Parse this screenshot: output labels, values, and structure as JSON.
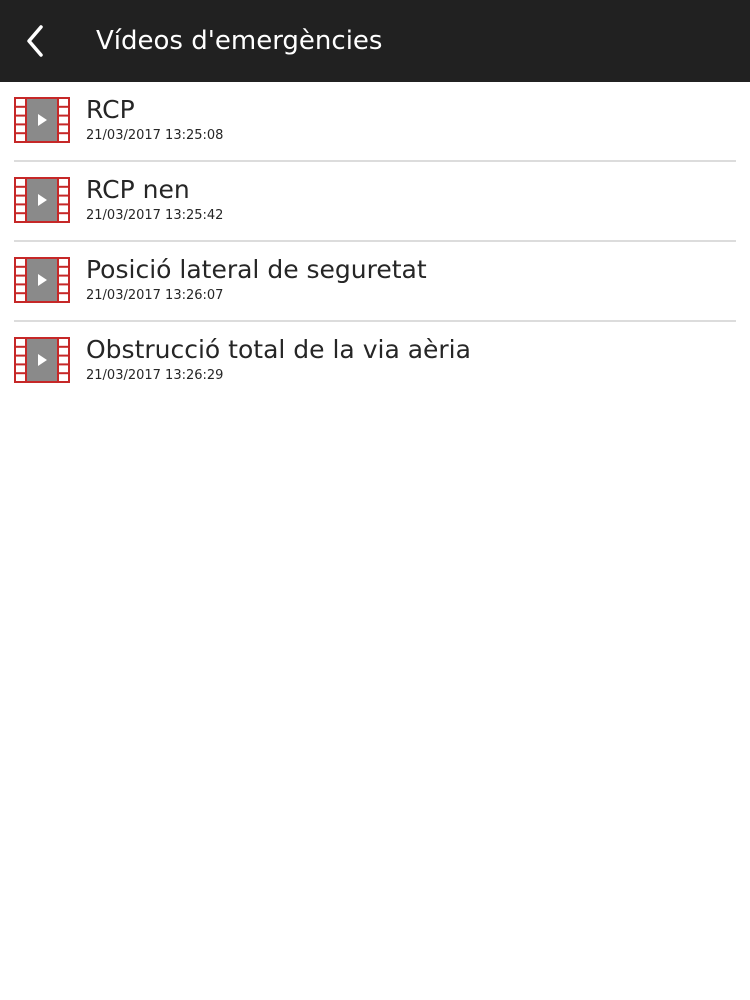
{
  "header": {
    "back_icon": "chevron-left-icon",
    "title": "Vídeos d'emergències",
    "background_color": "#212121"
  },
  "videos": [
    {
      "title": "RCP",
      "date": "21/03/2017 13:25:08",
      "icon": "film-video-icon"
    },
    {
      "title": "RCP nen",
      "date": "21/03/2017 13:25:42",
      "icon": "film-video-icon"
    },
    {
      "title": "Posició lateral de seguretat",
      "date": "21/03/2017 13:26:07",
      "icon": "film-video-icon"
    },
    {
      "title": "Obstrucció total de la via aèria",
      "date": "21/03/2017 13:26:29",
      "icon": "film-video-icon"
    }
  ],
  "colors": {
    "film_border": "#c62828",
    "film_screen": "#8a8a8a",
    "divider": "#dcdcdc"
  }
}
